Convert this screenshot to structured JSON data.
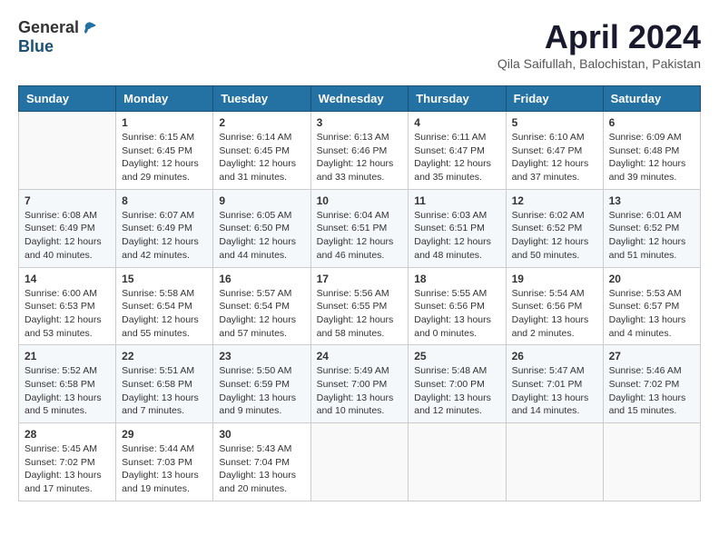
{
  "header": {
    "logo_general": "General",
    "logo_blue": "Blue",
    "month_title": "April 2024",
    "location": "Qila Saifullah, Balochistan, Pakistan"
  },
  "days_of_week": [
    "Sunday",
    "Monday",
    "Tuesday",
    "Wednesday",
    "Thursday",
    "Friday",
    "Saturday"
  ],
  "weeks": [
    [
      {
        "day": "",
        "info": ""
      },
      {
        "day": "1",
        "info": "Sunrise: 6:15 AM\nSunset: 6:45 PM\nDaylight: 12 hours\nand 29 minutes."
      },
      {
        "day": "2",
        "info": "Sunrise: 6:14 AM\nSunset: 6:45 PM\nDaylight: 12 hours\nand 31 minutes."
      },
      {
        "day": "3",
        "info": "Sunrise: 6:13 AM\nSunset: 6:46 PM\nDaylight: 12 hours\nand 33 minutes."
      },
      {
        "day": "4",
        "info": "Sunrise: 6:11 AM\nSunset: 6:47 PM\nDaylight: 12 hours\nand 35 minutes."
      },
      {
        "day": "5",
        "info": "Sunrise: 6:10 AM\nSunset: 6:47 PM\nDaylight: 12 hours\nand 37 minutes."
      },
      {
        "day": "6",
        "info": "Sunrise: 6:09 AM\nSunset: 6:48 PM\nDaylight: 12 hours\nand 39 minutes."
      }
    ],
    [
      {
        "day": "7",
        "info": "Sunrise: 6:08 AM\nSunset: 6:49 PM\nDaylight: 12 hours\nand 40 minutes."
      },
      {
        "day": "8",
        "info": "Sunrise: 6:07 AM\nSunset: 6:49 PM\nDaylight: 12 hours\nand 42 minutes."
      },
      {
        "day": "9",
        "info": "Sunrise: 6:05 AM\nSunset: 6:50 PM\nDaylight: 12 hours\nand 44 minutes."
      },
      {
        "day": "10",
        "info": "Sunrise: 6:04 AM\nSunset: 6:51 PM\nDaylight: 12 hours\nand 46 minutes."
      },
      {
        "day": "11",
        "info": "Sunrise: 6:03 AM\nSunset: 6:51 PM\nDaylight: 12 hours\nand 48 minutes."
      },
      {
        "day": "12",
        "info": "Sunrise: 6:02 AM\nSunset: 6:52 PM\nDaylight: 12 hours\nand 50 minutes."
      },
      {
        "day": "13",
        "info": "Sunrise: 6:01 AM\nSunset: 6:52 PM\nDaylight: 12 hours\nand 51 minutes."
      }
    ],
    [
      {
        "day": "14",
        "info": "Sunrise: 6:00 AM\nSunset: 6:53 PM\nDaylight: 12 hours\nand 53 minutes."
      },
      {
        "day": "15",
        "info": "Sunrise: 5:58 AM\nSunset: 6:54 PM\nDaylight: 12 hours\nand 55 minutes."
      },
      {
        "day": "16",
        "info": "Sunrise: 5:57 AM\nSunset: 6:54 PM\nDaylight: 12 hours\nand 57 minutes."
      },
      {
        "day": "17",
        "info": "Sunrise: 5:56 AM\nSunset: 6:55 PM\nDaylight: 12 hours\nand 58 minutes."
      },
      {
        "day": "18",
        "info": "Sunrise: 5:55 AM\nSunset: 6:56 PM\nDaylight: 13 hours\nand 0 minutes."
      },
      {
        "day": "19",
        "info": "Sunrise: 5:54 AM\nSunset: 6:56 PM\nDaylight: 13 hours\nand 2 minutes."
      },
      {
        "day": "20",
        "info": "Sunrise: 5:53 AM\nSunset: 6:57 PM\nDaylight: 13 hours\nand 4 minutes."
      }
    ],
    [
      {
        "day": "21",
        "info": "Sunrise: 5:52 AM\nSunset: 6:58 PM\nDaylight: 13 hours\nand 5 minutes."
      },
      {
        "day": "22",
        "info": "Sunrise: 5:51 AM\nSunset: 6:58 PM\nDaylight: 13 hours\nand 7 minutes."
      },
      {
        "day": "23",
        "info": "Sunrise: 5:50 AM\nSunset: 6:59 PM\nDaylight: 13 hours\nand 9 minutes."
      },
      {
        "day": "24",
        "info": "Sunrise: 5:49 AM\nSunset: 7:00 PM\nDaylight: 13 hours\nand 10 minutes."
      },
      {
        "day": "25",
        "info": "Sunrise: 5:48 AM\nSunset: 7:00 PM\nDaylight: 13 hours\nand 12 minutes."
      },
      {
        "day": "26",
        "info": "Sunrise: 5:47 AM\nSunset: 7:01 PM\nDaylight: 13 hours\nand 14 minutes."
      },
      {
        "day": "27",
        "info": "Sunrise: 5:46 AM\nSunset: 7:02 PM\nDaylight: 13 hours\nand 15 minutes."
      }
    ],
    [
      {
        "day": "28",
        "info": "Sunrise: 5:45 AM\nSunset: 7:02 PM\nDaylight: 13 hours\nand 17 minutes."
      },
      {
        "day": "29",
        "info": "Sunrise: 5:44 AM\nSunset: 7:03 PM\nDaylight: 13 hours\nand 19 minutes."
      },
      {
        "day": "30",
        "info": "Sunrise: 5:43 AM\nSunset: 7:04 PM\nDaylight: 13 hours\nand 20 minutes."
      },
      {
        "day": "",
        "info": ""
      },
      {
        "day": "",
        "info": ""
      },
      {
        "day": "",
        "info": ""
      },
      {
        "day": "",
        "info": ""
      }
    ]
  ]
}
